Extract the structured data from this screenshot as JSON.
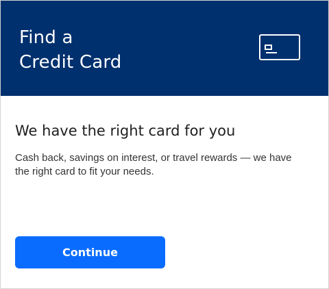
{
  "header": {
    "title_line_1": "Find a",
    "title_line_2": "Credit Card",
    "background_color": "#00306e",
    "icon": "credit-card-icon"
  },
  "main": {
    "heading": "We have the right card for you",
    "description": "Cash back, savings on interest, or travel rewards — we have the right card to fit your needs."
  },
  "actions": {
    "continue_label": "Continue",
    "button_color": "#0a6cff"
  }
}
